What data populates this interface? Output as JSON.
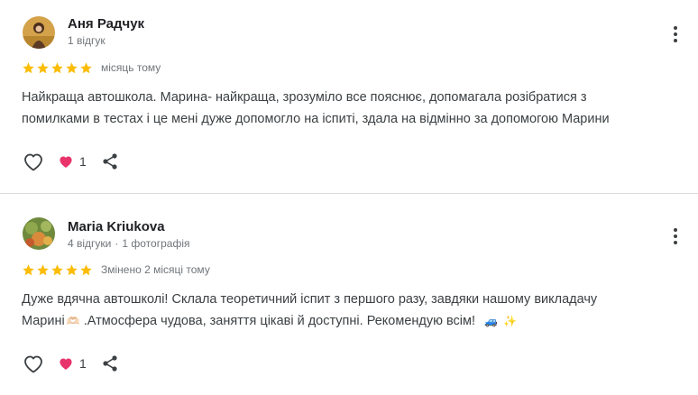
{
  "reviews": [
    {
      "author": "Аня Радчук",
      "meta_reviews": "1 відгук",
      "meta_photos": "",
      "rating": 5,
      "when": "місяць тому",
      "text_lines": [
        "Найкраща автошкола. Марина- найкраща, зрозуміло все пояснює, допомагала розібратися з",
        "помилками в тестах і це мені дуже допомогло на іспиті, здала на відмінно за допомогою Марини"
      ],
      "reaction_count": "1"
    },
    {
      "author": "Maria Kriukova",
      "meta_reviews": "4 відгуки",
      "meta_separator": "·",
      "meta_photos": "1 фотографія",
      "rating": 5,
      "when": "Змінено 2 місяці тому",
      "text_line1": "Дуже вдячна автошколі! Склала теоретичний іспит з першого разу, завдяки нашому викладачу",
      "text_line2_a": "Марині",
      "emoji_hands": "🫶🏻",
      "text_line2_b": ".Атмосфера чудова, заняття цікаві й доступні. Рекомендую всім!",
      "emoji_car": "🚙",
      "emoji_sparkles": "✨",
      "reaction_count": "1"
    }
  ],
  "colors": {
    "star": "#fbbc04",
    "heart": "#e8336b",
    "text": "#3c4043",
    "meta": "#70757a",
    "divider": "#dadce0"
  },
  "icons": {
    "more": "more-vert-icon",
    "like": "heart-outline-icon",
    "reaction": "heart-filled-icon",
    "share": "share-icon",
    "star": "star-icon"
  }
}
